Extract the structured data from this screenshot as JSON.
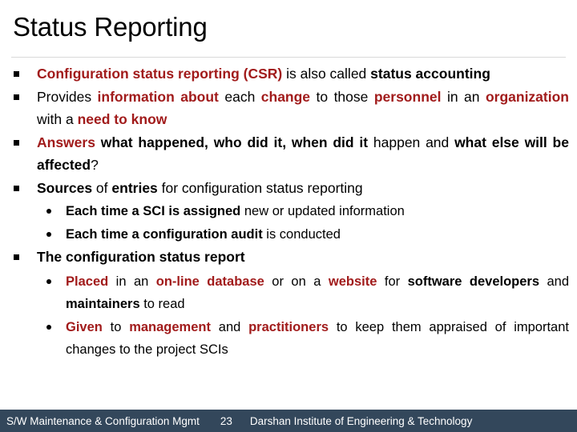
{
  "slide": {
    "title": "Status Reporting",
    "page_number": "23",
    "accent_red": "#A11B1B",
    "footer_bg": "#33475B",
    "text_color": "#000000"
  },
  "bullets": [
    {
      "level": 1,
      "marker": "square-bullet",
      "runs": [
        {
          "text": "Configuration status reporting (CSR)",
          "style": "red-bold"
        },
        {
          "text": " is also called ",
          "style": "regular"
        },
        {
          "text": "status accounting",
          "style": "bold"
        }
      ]
    },
    {
      "level": 1,
      "marker": "square-bullet",
      "runs": [
        {
          "text": "Provides ",
          "style": "regular"
        },
        {
          "text": "information about",
          "style": "red-bold"
        },
        {
          "text": " each ",
          "style": "regular"
        },
        {
          "text": "change",
          "style": "red-bold"
        },
        {
          "text": " to those ",
          "style": "regular"
        },
        {
          "text": "personnel",
          "style": "red-bold"
        },
        {
          "text": " in an ",
          "style": "regular"
        },
        {
          "text": "organization",
          "style": "red-bold"
        },
        {
          "text": " with a ",
          "style": "regular"
        },
        {
          "text": "need to know",
          "style": "red-bold"
        }
      ]
    },
    {
      "level": 1,
      "marker": "square-bullet",
      "runs": [
        {
          "text": "Answers",
          "style": "red-bold"
        },
        {
          "text": " ",
          "style": "regular"
        },
        {
          "text": "what happened, who did it, when did it",
          "style": "bold"
        },
        {
          "text": " happen and ",
          "style": "regular"
        },
        {
          "text": "what else will be affected",
          "style": "bold"
        },
        {
          "text": "?",
          "style": "regular"
        }
      ]
    },
    {
      "level": 1,
      "marker": "square-bullet",
      "runs": [
        {
          "text": "Sources",
          "style": "bold"
        },
        {
          "text": " of ",
          "style": "regular"
        },
        {
          "text": "entries",
          "style": "bold"
        },
        {
          "text": " for configuration status reporting",
          "style": "regular"
        }
      ]
    },
    {
      "level": 2,
      "marker": "dot-bullet",
      "runs": [
        {
          "text": "Each time a SCI is assigned",
          "style": "bold"
        },
        {
          "text": " new or updated information",
          "style": "regular"
        }
      ]
    },
    {
      "level": 2,
      "marker": "dot-bullet",
      "runs": [
        {
          "text": "Each time a configuration audit",
          "style": "bold"
        },
        {
          "text": " is conducted",
          "style": "regular"
        }
      ]
    },
    {
      "level": 1,
      "marker": "square-bullet",
      "runs": [
        {
          "text": "The configuration status report",
          "style": "bold"
        }
      ]
    },
    {
      "level": 2,
      "marker": "dot-bullet",
      "runs": [
        {
          "text": "Placed",
          "style": "red-bold"
        },
        {
          "text": " in an ",
          "style": "regular"
        },
        {
          "text": "on-line database",
          "style": "red-bold"
        },
        {
          "text": " or on a ",
          "style": "regular"
        },
        {
          "text": "website",
          "style": "red-bold"
        },
        {
          "text": " for ",
          "style": "regular"
        },
        {
          "text": "software developers",
          "style": "bold"
        },
        {
          "text": " and ",
          "style": "regular"
        },
        {
          "text": "maintainers",
          "style": "bold"
        },
        {
          "text": " to read",
          "style": "regular"
        }
      ]
    },
    {
      "level": 2,
      "marker": "dot-bullet",
      "runs": [
        {
          "text": "Given",
          "style": "red-bold"
        },
        {
          "text": " to ",
          "style": "regular"
        },
        {
          "text": "management",
          "style": "red-bold"
        },
        {
          "text": " and ",
          "style": "regular"
        },
        {
          "text": "practitioners",
          "style": "red-bold"
        },
        {
          "text": " to keep them appraised of important changes to the project SCIs",
          "style": "regular"
        }
      ]
    }
  ],
  "footer": {
    "left": "S/W Maintenance & Configuration Mgmt",
    "page": "23",
    "right": "Darshan Institute of Engineering & Technology"
  }
}
